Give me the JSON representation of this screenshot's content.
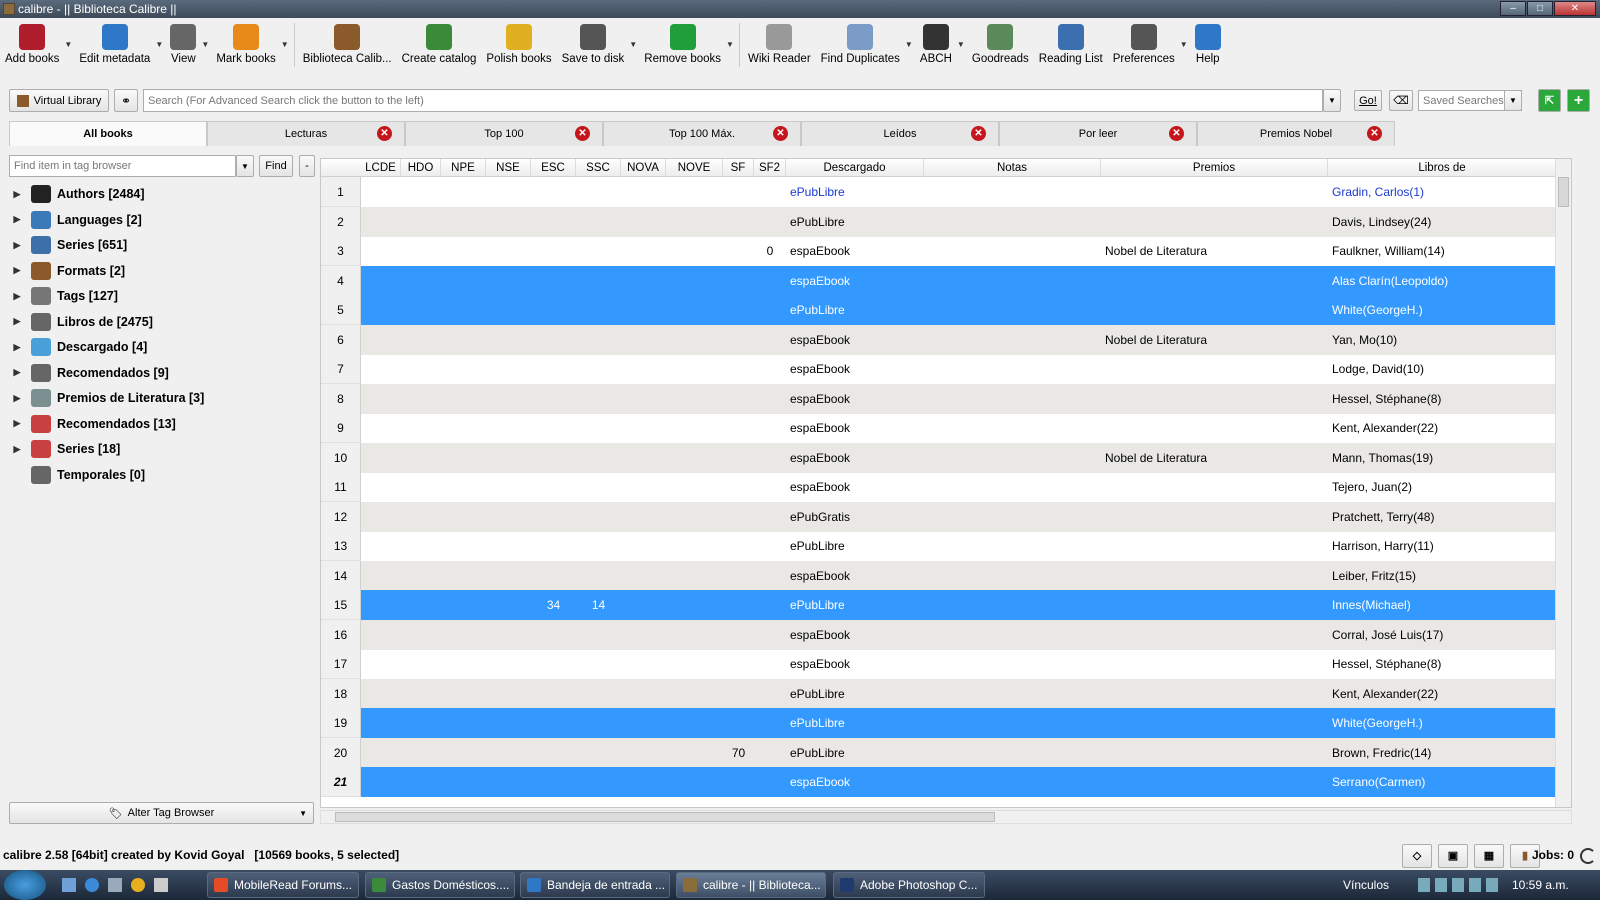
{
  "window": {
    "title": "calibre - || Biblioteca Calibre ||"
  },
  "toolbar": {
    "items": [
      {
        "label": "Add books",
        "icon": "add-book-icon",
        "color": "#b01e2d",
        "dd": true
      },
      {
        "label": "Edit metadata",
        "icon": "info-icon",
        "color": "#2f78c8",
        "dd": true
      },
      {
        "label": "View",
        "icon": "magnifier-icon",
        "color": "#666666",
        "dd": true
      },
      {
        "label": "Mark books",
        "icon": "pin-icon",
        "color": "#e88a1a",
        "dd": true
      },
      {
        "label": "Biblioteca Calib...",
        "icon": "library-icon",
        "color": "#8a5a2b",
        "dd": false
      },
      {
        "label": "Create catalog",
        "icon": "catalog-icon",
        "color": "#3a8a3a",
        "dd": false
      },
      {
        "label": "Polish books",
        "icon": "brush-icon",
        "color": "#e0b020",
        "dd": false
      },
      {
        "label": "Save to disk",
        "icon": "save-icon",
        "color": "#555555",
        "dd": true
      },
      {
        "label": "Remove books",
        "icon": "recycle-icon",
        "color": "#1f9e3a",
        "dd": true
      },
      {
        "label": "Wiki Reader",
        "icon": "globe-icon",
        "color": "#999999",
        "dd": false
      },
      {
        "label": "Find Duplicates",
        "icon": "duplicates-icon",
        "color": "#7a9cc6",
        "dd": true
      },
      {
        "label": "ABCH",
        "icon": "book-icon",
        "color": "#333333",
        "dd": true
      },
      {
        "label": "Goodreads",
        "icon": "goodreads-icon",
        "color": "#5a8a5a",
        "dd": false
      },
      {
        "label": "Reading List",
        "icon": "reading-list-icon",
        "color": "#3b6fb0",
        "dd": false
      },
      {
        "label": "Preferences",
        "icon": "gear-icon",
        "color": "#555555",
        "dd": true
      },
      {
        "label": "Help",
        "icon": "help-icon",
        "color": "#2f78c8",
        "dd": false
      }
    ]
  },
  "search": {
    "virtual_library": "Virtual Library",
    "placeholder": "Search (For Advanced Search click the button to the left)",
    "go": "Go!",
    "saved": "Saved Searches"
  },
  "tabs": [
    {
      "label": "All books",
      "active": true
    },
    {
      "label": "Lecturas"
    },
    {
      "label": "Top 100"
    },
    {
      "label": "Top 100 Máx."
    },
    {
      "label": "Leídos"
    },
    {
      "label": "Por leer"
    },
    {
      "label": "Premios Nobel"
    }
  ],
  "tagbrowser": {
    "find_placeholder": "Find item in tag browser",
    "find": "Find",
    "minus": "-",
    "alter": "Alter Tag Browser",
    "items": [
      {
        "label": "Authors [2484]",
        "color": "#222222",
        "arrow": true
      },
      {
        "label": "Languages [2]",
        "color": "#3a7ab8",
        "arrow": true
      },
      {
        "label": "Series [651]",
        "color": "#3d6fa8",
        "arrow": true
      },
      {
        "label": "Formats [2]",
        "color": "#8a5a2b",
        "arrow": true
      },
      {
        "label": "Tags [127]",
        "color": "#777777",
        "arrow": true
      },
      {
        "label": "Libros de [2475]",
        "color": "#666666",
        "arrow": true
      },
      {
        "label": "Descargado [4]",
        "color": "#4aa0d8",
        "arrow": true
      },
      {
        "label": "Recomendados [9]",
        "color": "#666666",
        "arrow": true
      },
      {
        "label": "Premios de Literatura [3]",
        "color": "#7a9090",
        "arrow": true
      },
      {
        "label": "Recomendados [13]",
        "color": "#c84040",
        "arrow": true
      },
      {
        "label": "Series [18]",
        "color": "#c84040",
        "arrow": true
      },
      {
        "label": "Temporales [0]",
        "color": "#666666",
        "arrow": false
      }
    ]
  },
  "columns": [
    "LCDE",
    "HDO",
    "NPE",
    "NSE",
    "ESC",
    "SSC",
    "NOVA",
    "NOVE",
    "SF",
    "SF2",
    "Descargado",
    "Notas",
    "Premios",
    "Libros de"
  ],
  "rows": [
    {
      "n": "1",
      "sf2": "",
      "desc": "ePubLibre",
      "prem": "",
      "lib": "Gradin, Carlos(1)",
      "style": "link"
    },
    {
      "n": "2",
      "desc": "ePubLibre",
      "lib": "Davis, Lindsey(24)",
      "style": "alt"
    },
    {
      "n": "3",
      "sf2": "0",
      "desc": "espaEbook",
      "prem": "Nobel de Literatura",
      "lib": "Faulkner, William(14)"
    },
    {
      "n": "4",
      "desc": "espaEbook",
      "lib": "Alas Clarín(Leopoldo)",
      "style": "sel"
    },
    {
      "n": "5",
      "desc": "ePubLibre",
      "lib": "White(GeorgeH.)",
      "style": "sel"
    },
    {
      "n": "6",
      "desc": "espaEbook",
      "prem": "Nobel de Literatura",
      "lib": "Yan, Mo(10)",
      "style": "alt"
    },
    {
      "n": "7",
      "desc": "espaEbook",
      "lib": "Lodge, David(10)"
    },
    {
      "n": "8",
      "desc": "espaEbook",
      "lib": "Hessel, Stéphane(8)",
      "style": "alt"
    },
    {
      "n": "9",
      "desc": "espaEbook",
      "lib": "Kent, Alexander(22)"
    },
    {
      "n": "10",
      "desc": "espaEbook",
      "prem": "Nobel de Literatura",
      "lib": "Mann, Thomas(19)",
      "style": "alt"
    },
    {
      "n": "11",
      "desc": "espaEbook",
      "lib": "Tejero, Juan(2)"
    },
    {
      "n": "12",
      "desc": "ePubGratis",
      "lib": "Pratchett, Terry(48)",
      "style": "alt"
    },
    {
      "n": "13",
      "desc": "ePubLibre",
      "lib": "Harrison, Harry(11)"
    },
    {
      "n": "14",
      "desc": "espaEbook",
      "lib": "Leiber, Fritz(15)",
      "style": "alt"
    },
    {
      "n": "15",
      "esc": "34",
      "ssc": "14",
      "desc": "ePubLibre",
      "lib": "Innes(Michael)",
      "style": "sel"
    },
    {
      "n": "16",
      "desc": "espaEbook",
      "lib": "Corral, José Luis(17)",
      "style": "alt"
    },
    {
      "n": "17",
      "desc": "espaEbook",
      "lib": "Hessel, Stéphane(8)"
    },
    {
      "n": "18",
      "desc": "ePubLibre",
      "lib": "Kent, Alexander(22)",
      "style": "alt"
    },
    {
      "n": "19",
      "desc": "ePubLibre",
      "lib": "White(GeorgeH.)",
      "style": "sel"
    },
    {
      "n": "20",
      "sf": "70",
      "desc": "ePubLibre",
      "lib": "Brown, Fredric(14)",
      "style": "alt"
    },
    {
      "n": "21",
      "desc": "espaEbook",
      "lib": "Serrano(Carmen)",
      "style": "sel"
    }
  ],
  "status": {
    "left": "calibre 2.58 [64bit] created by Kovid Goyal   [10569 books, 5 selected]",
    "jobs": "Jobs: 0"
  },
  "taskbar": {
    "items": [
      {
        "label": "MobileRead Forums...",
        "color": "#e34c26"
      },
      {
        "label": "Gastos Domésticos....",
        "color": "#3c8a3c"
      },
      {
        "label": "Bandeja de entrada ...",
        "color": "#2f78c8"
      },
      {
        "label": "calibre - || Biblioteca...",
        "color": "#8a6d3b"
      },
      {
        "label": "Adobe Photoshop C...",
        "color": "#1e3a6e"
      }
    ],
    "vinculos": "Vínculos",
    "clock": "10:59 a.m."
  }
}
